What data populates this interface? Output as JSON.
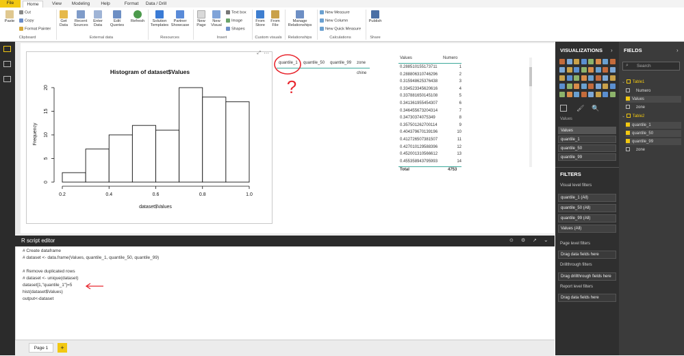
{
  "tabs": {
    "file": "File",
    "items": [
      "Home",
      "View",
      "Modeling",
      "Help",
      "Format",
      "Data / Drill"
    ]
  },
  "ribbon": {
    "clipboard": {
      "paste": "Paste",
      "cut": "Cut",
      "copy": "Copy",
      "format_painter": "Format Painter",
      "group": "Clipboard"
    },
    "external": {
      "get_data": "Get Data",
      "recent": "Recent Sources",
      "enter": "Enter Data",
      "edit": "Edit Queries",
      "refresh": "Refresh",
      "group": "External data"
    },
    "resources": {
      "solution": "Solution Templates",
      "partner": "Partner Showcase",
      "group": "Resources"
    },
    "insert": {
      "new_page": "New Page",
      "new_visual": "New Visual",
      "text_box": "Text box",
      "image": "Image",
      "shapes": "Shapes",
      "group": "Insert"
    },
    "custom": {
      "from_store": "From Store",
      "from_file": "From File",
      "group": "Custom visuals"
    },
    "relationships": {
      "manage": "Manage Relationships",
      "group": "Relationships"
    },
    "calculations": {
      "new_measure": "New Measure",
      "new_column": "New Column",
      "new_quick": "New Quick Measure",
      "group": "Calculations"
    },
    "share": {
      "publish": "Publish",
      "group": "Share"
    }
  },
  "histogram": {
    "title": "Histogram of dataset$Values",
    "xlabel": "dataset$Values",
    "ylabel": "Frequency",
    "xticks": [
      "0.2",
      "0.4",
      "0.6",
      "0.8",
      "1.0"
    ],
    "yticks": [
      "0",
      "5",
      "10",
      "15",
      "20"
    ]
  },
  "chart_data": {
    "type": "bar",
    "title": "Histogram of dataset$Values",
    "xlabel": "dataset$Values",
    "ylabel": "Frequency",
    "bins": [
      [
        0.2,
        0.3
      ],
      [
        0.3,
        0.4
      ],
      [
        0.4,
        0.5
      ],
      [
        0.5,
        0.6
      ],
      [
        0.6,
        0.7
      ],
      [
        0.7,
        0.8
      ],
      [
        0.8,
        0.9
      ],
      [
        0.9,
        1.0
      ]
    ],
    "values": [
      2,
      7,
      10,
      12,
      11,
      20,
      18,
      17
    ],
    "xlim": [
      0.2,
      1.0
    ],
    "ylim": [
      0,
      20
    ]
  },
  "quantile_table": {
    "headers": [
      "quantile_1",
      "quantile_50",
      "quantile_99",
      "zone"
    ],
    "zone": "chine"
  },
  "values_table": {
    "headers": [
      "Values",
      "Numero"
    ],
    "rows": [
      [
        "0.288510155173711",
        "1"
      ],
      [
        "0.288806310746296",
        "2"
      ],
      [
        "0.315948625376438",
        "3"
      ],
      [
        "0.334523345620616",
        "4"
      ],
      [
        "0.337881650145108",
        "5"
      ],
      [
        "0.341361955454307",
        "6"
      ],
      [
        "0.346455673204314",
        "7"
      ],
      [
        "0.34730374075349",
        "8"
      ],
      [
        "0.357501262700114",
        "9"
      ],
      [
        "0.404379670139196",
        "10"
      ],
      [
        "0.412726507381507",
        "11"
      ],
      [
        "0.427010129588396",
        "12"
      ],
      [
        "0.452001310566612",
        "13"
      ],
      [
        "0.455358943795993",
        "14"
      ]
    ],
    "total_label": "Total",
    "total": "4753"
  },
  "editor": {
    "title": "R script editor",
    "lines": [
      "# Create dataframe",
      "# dataset <- data.frame(Values, quantile_1, quantile_50, quantile_99)",
      "",
      "# Remove duplicated rows",
      "# dataset <- unique(dataset)",
      "dataset[1,\"quantile_1\"]=5",
      "hist(dataset$Values)",
      "output<-dataset"
    ]
  },
  "pages": {
    "page1": "Page 1",
    "add": "+"
  },
  "visualizations": {
    "title": "VISUALIZATIONS",
    "values_label": "Values",
    "wells": [
      "Values",
      "quantile_1",
      "quantile_50",
      "quantile_99"
    ],
    "filters_title": "FILTERS",
    "visual_level": "Visual level filters",
    "visual_filters": [
      "quantile_1 (All)",
      "quantile_50 (All)",
      "quantile_99 (All)",
      "Values (All)"
    ],
    "page_level": "Page level filters",
    "drag1": "Drag data fields here",
    "drillthrough": "Drillthrough filters",
    "drag2": "Drag drillthrough fields here",
    "report_level": "Report level filters",
    "drag3": "Drag data fields here"
  },
  "fields": {
    "title": "FIELDS",
    "search_placeholder": "Search",
    "table1": "Table1",
    "table1_fields": [
      {
        "name": "Numero",
        "checked": false
      },
      {
        "name": "Values",
        "checked": true
      },
      {
        "name": "zone",
        "checked": false
      }
    ],
    "table2": "Table2",
    "table2_fields": [
      {
        "name": "quantile_1",
        "checked": true
      },
      {
        "name": "quantile_50",
        "checked": true
      },
      {
        "name": "quantile_99",
        "checked": true
      },
      {
        "name": "zone",
        "checked": false
      }
    ]
  },
  "colors": {
    "accent": "#f2c811",
    "annotation": "#e8262e",
    "dark_pane": "#2f2f2f"
  }
}
